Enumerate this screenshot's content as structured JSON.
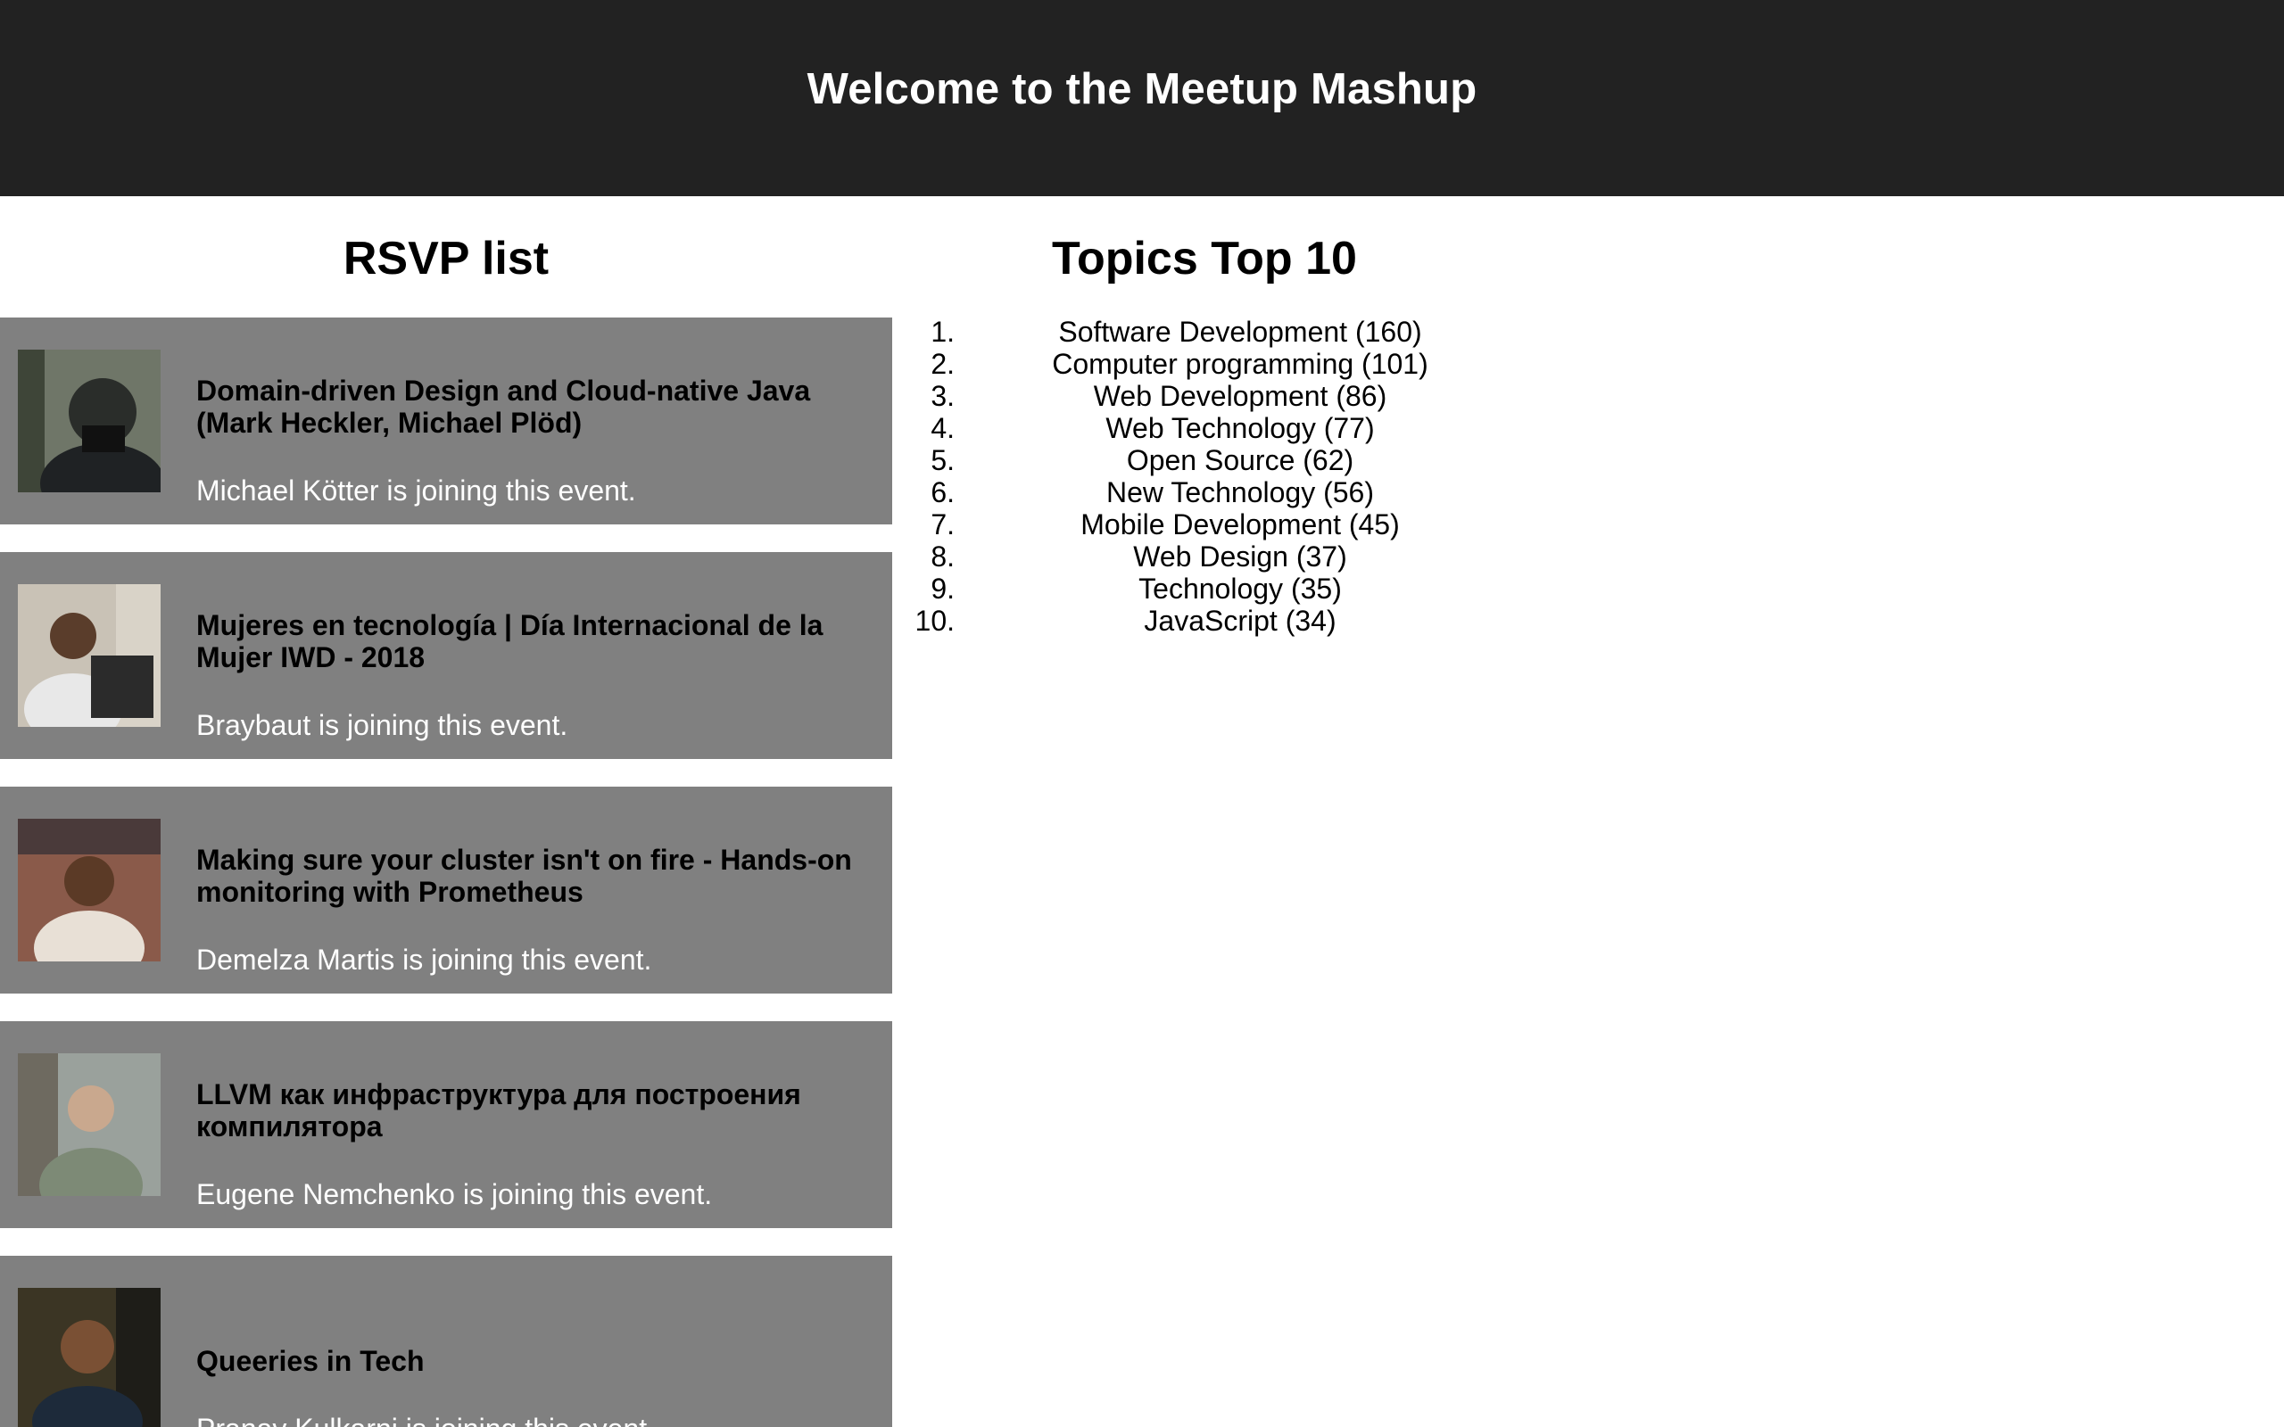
{
  "header": {
    "title": "Welcome to the Meetup Mashup"
  },
  "rsvp": {
    "heading": "RSVP list",
    "items": [
      {
        "event": "Domain-driven Design and Cloud-native Java (Mark Heckler, Michael Plöd)",
        "member": "Michael Kötter is joining this event."
      },
      {
        "event": "Mujeres en tecnología | Día Internacional de la Mujer IWD - 2018",
        "member": "Braybaut is joining this event."
      },
      {
        "event": "Making sure your cluster isn't on fire - Hands-on monitoring with Prometheus",
        "member": "Demelza Martis is joining this event."
      },
      {
        "event": "LLVM как инфраструктура для построения компилятора",
        "member": "Eugene Nemchenko is joining this event."
      },
      {
        "event": "Queeries in Tech",
        "member": "Pranav Kulkarni is joining this event."
      }
    ]
  },
  "topics": {
    "heading": "Topics Top 10",
    "items": [
      {
        "num": "1.",
        "label": "Software Development (160)"
      },
      {
        "num": "2.",
        "label": "Computer programming (101)"
      },
      {
        "num": "3.",
        "label": "Web Development (86)"
      },
      {
        "num": "4.",
        "label": "Web Technology (77)"
      },
      {
        "num": "5.",
        "label": "Open Source (62)"
      },
      {
        "num": "6.",
        "label": "New Technology (56)"
      },
      {
        "num": "7.",
        "label": "Mobile Development (45)"
      },
      {
        "num": "8.",
        "label": "Web Design (37)"
      },
      {
        "num": "9.",
        "label": "Technology (35)"
      },
      {
        "num": "10.",
        "label": "JavaScript (34)"
      }
    ]
  },
  "colors": {
    "header_bg": "#222222",
    "card_bg": "#808080",
    "joining_text": "#ffffff"
  }
}
